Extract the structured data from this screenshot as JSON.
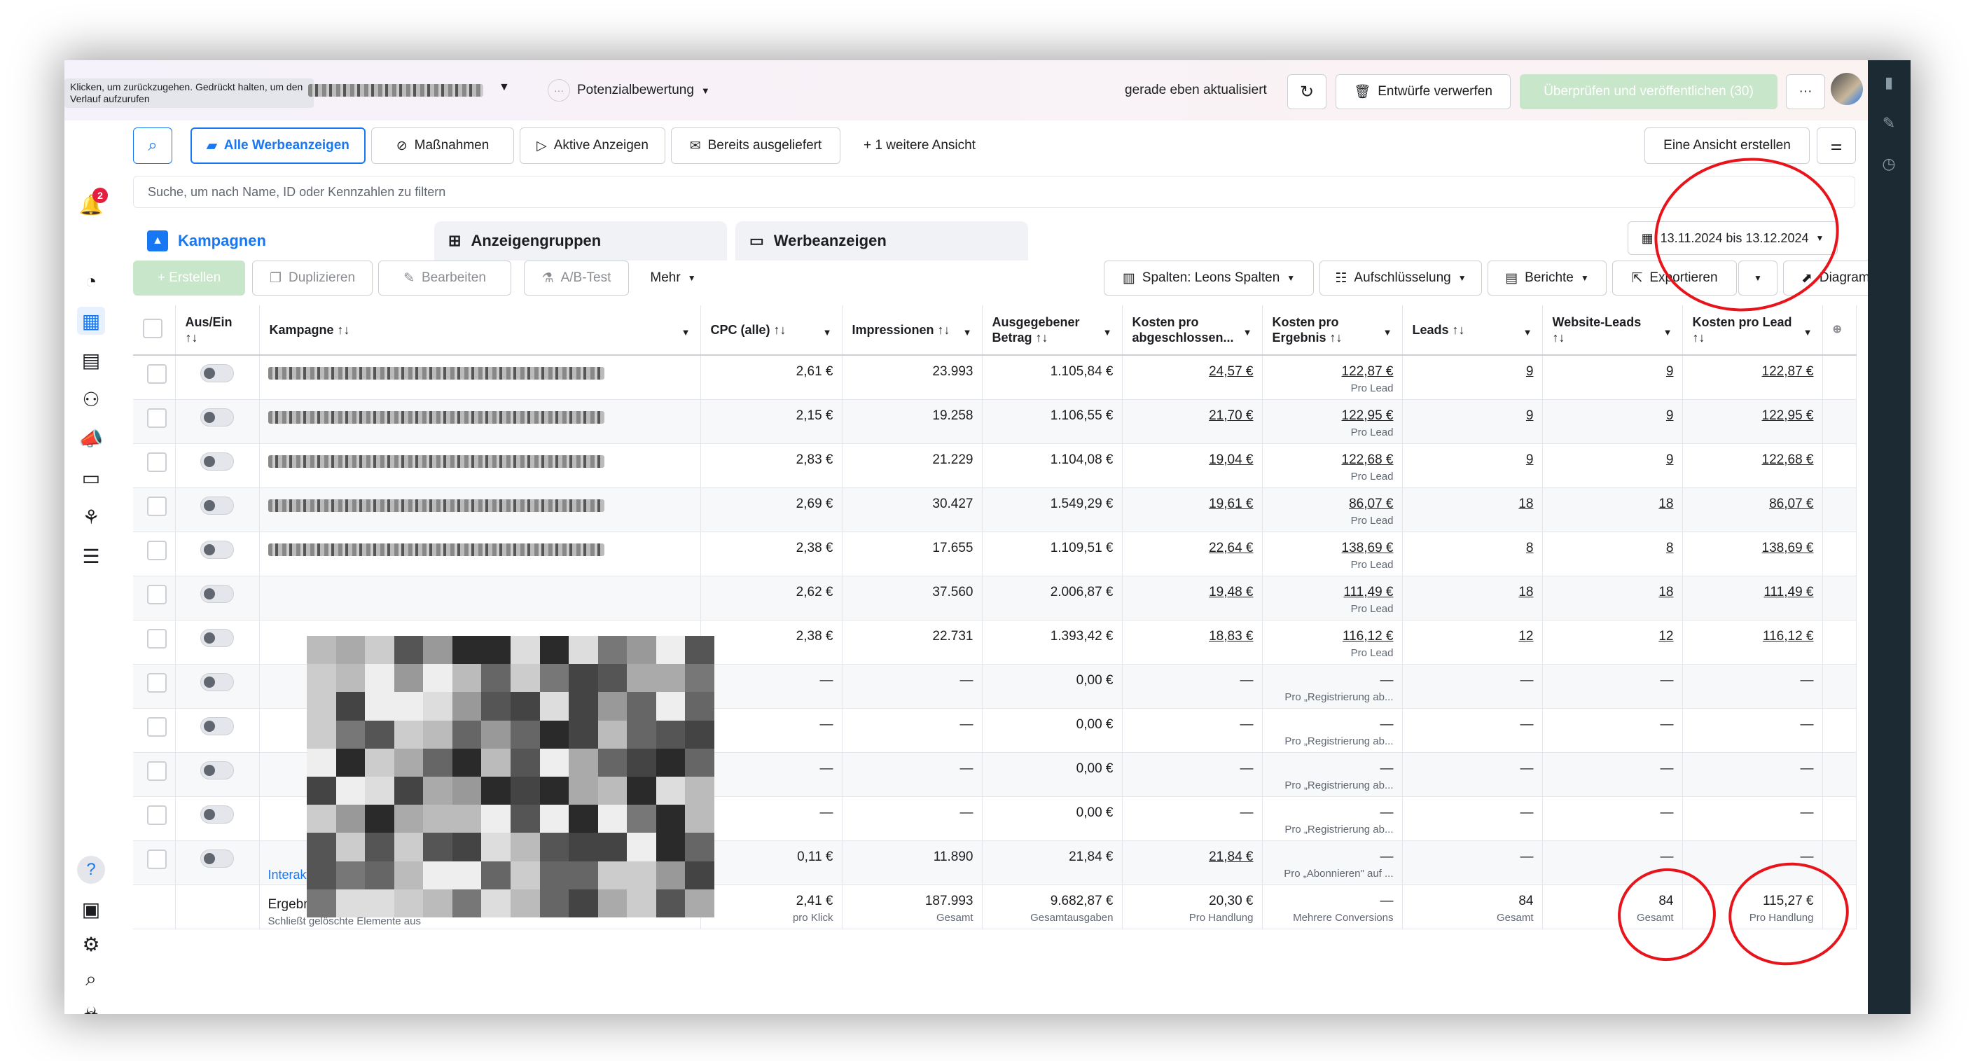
{
  "tooltip": "Klicken, um zurückzugehen. Gedrückt halten, um den Verlauf aufzurufen",
  "header": {
    "potential_label": "Potenzialbewertung",
    "updated": "gerade eben aktualisiert",
    "discard": "Entwürfe verwerfen",
    "publish": "Überprüfen und veröffentlichen (30)",
    "more": "···",
    "notification_count": "2"
  },
  "views": {
    "all_ads": "Alle Werbeanzeigen",
    "actions": "Maßnahmen",
    "active_ads": "Aktive Anzeigen",
    "delivered": "Bereits ausgeliefert",
    "more_view": "+ 1 weitere Ansicht",
    "create_view": "Eine Ansicht erstellen"
  },
  "search": {
    "placeholder": "Suche, um nach Name, ID oder Kennzahlen zu filtern"
  },
  "tabs": {
    "campaigns": "Kampagnen",
    "adsets": "Anzeigengruppen",
    "ads": "Werbeanzeigen"
  },
  "date_range": "13.11.2024 bis 13.12.2024",
  "toolbar": {
    "create": "+ Erstellen",
    "duplicate": "Duplizieren",
    "edit": "Bearbeiten",
    "abtest": "A/B-Test",
    "more": "Mehr",
    "columns": "Spalten: Leons Spalten",
    "breakdown": "Aufschlüsselung",
    "reports": "Berichte",
    "export": "Exportieren",
    "charts": "Diagramme"
  },
  "columns": {
    "onoff": "Aus/Ein",
    "sortglyph": "↑↓",
    "campaign": "Kampagne ↑↓",
    "cpc": "CPC (alle) ↑↓",
    "impressions": "Impressionen ↑↓",
    "spend_a": "Ausgegebener",
    "spend_b": "Betrag ↑↓",
    "cost_complete_a": "Kosten pro",
    "cost_complete_b": "abgeschlossen...",
    "cost_result_a": "Kosten pro",
    "cost_result_b": "Ergebnis ↑↓",
    "leads": "Leads ↑↓",
    "website_leads_a": "Website-Leads",
    "website_leads_b": "↑↓",
    "cost_lead_a": "Kosten pro Lead",
    "cost_lead_b": "↑↓"
  },
  "rows": [
    {
      "cpc": "2,61 €",
      "impr": "23.993",
      "spend": "1.105,84 €",
      "ccomp": "24,57 €",
      "cres": "122,87 €",
      "cres_sub": "Pro Lead",
      "leads": "9",
      "wleads": "9",
      "clead": "122,87 €"
    },
    {
      "cpc": "2,15 €",
      "impr": "19.258",
      "spend": "1.106,55 €",
      "ccomp": "21,70 €",
      "cres": "122,95 €",
      "cres_sub": "Pro Lead",
      "leads": "9",
      "wleads": "9",
      "clead": "122,95 €"
    },
    {
      "cpc": "2,83 €",
      "impr": "21.229",
      "spend": "1.104,08 €",
      "ccomp": "19,04 €",
      "cres": "122,68 €",
      "cres_sub": "Pro Lead",
      "leads": "9",
      "wleads": "9",
      "clead": "122,68 €"
    },
    {
      "cpc": "2,69 €",
      "impr": "30.427",
      "spend": "1.549,29 €",
      "ccomp": "19,61 €",
      "cres": "86,07 €",
      "cres_sub": "Pro Lead",
      "leads": "18",
      "wleads": "18",
      "clead": "86,07 €"
    },
    {
      "cpc": "2,38 €",
      "impr": "17.655",
      "spend": "1.109,51 €",
      "ccomp": "22,64 €",
      "cres": "138,69 €",
      "cres_sub": "Pro Lead",
      "leads": "8",
      "wleads": "8",
      "clead": "138,69 €"
    },
    {
      "cpc": "2,62 €",
      "impr": "37.560",
      "spend": "2.006,87 €",
      "ccomp": "19,48 €",
      "cres": "111,49 €",
      "cres_sub": "Pro Lead",
      "leads": "18",
      "wleads": "18",
      "clead": "111,49 €"
    },
    {
      "cpc": "2,38 €",
      "impr": "22.731",
      "spend": "1.393,42 €",
      "ccomp": "18,83 €",
      "cres": "116,12 €",
      "cres_sub": "Pro Lead",
      "leads": "12",
      "wleads": "12",
      "clead": "116,12 €"
    },
    {
      "cpc": "—",
      "impr": "—",
      "spend": "0,00 €",
      "ccomp": "—",
      "cres": "—",
      "cres_sub": "Pro „Registrierung ab...",
      "leads": "—",
      "wleads": "—",
      "clead": "—"
    },
    {
      "cpc": "—",
      "impr": "—",
      "spend": "0,00 €",
      "ccomp": "—",
      "cres": "—",
      "cres_sub": "Pro „Registrierung ab...",
      "leads": "—",
      "wleads": "—",
      "clead": "—"
    },
    {
      "cpc": "—",
      "impr": "—",
      "spend": "0,00 €",
      "ccomp": "—",
      "cres": "—",
      "cres_sub": "Pro „Registrierung ab...",
      "leads": "—",
      "wleads": "—",
      "clead": "—"
    },
    {
      "cpc": "—",
      "impr": "—",
      "spend": "0,00 €",
      "ccomp": "—",
      "cres": "—",
      "cres_sub": "Pro „Registrierung ab...",
      "leads": "—",
      "wleads": "—",
      "clead": "—"
    },
    {
      "cpc": "0,11 €",
      "impr": "11.890",
      "spend": "21,84 €",
      "ccomp": "21,84 €",
      "cres": "—",
      "cres_sub": "Pro „Abonnieren\" auf ...",
      "leads": "—",
      "wleads": "—",
      "clead": "—",
      "name_visible": "Interaktionen | Aufwärmen"
    }
  ],
  "totals": {
    "label": "Ergebnisse aus 17 Kampagnen",
    "sub": "Schließt gelöschte Elemente aus",
    "cpc": "2,41 €",
    "cpc_sub": "pro Klick",
    "impr": "187.993",
    "impr_sub": "Gesamt",
    "spend": "9.682,87 €",
    "spend_sub": "Gesamtausgaben",
    "ccomp": "20,30 €",
    "ccomp_sub": "Pro Handlung",
    "cres": "—",
    "cres_sub": "Mehrere Conversions",
    "leads": "84",
    "leads_sub": "Gesamt",
    "wleads": "84",
    "wleads_sub": "Gesamt",
    "clead": "115,27 €",
    "clead_sub": "Pro Handlung"
  },
  "colors": {
    "accent": "#1877f2",
    "annotation": "#e8141b",
    "sidebar_dark": "#1c2b33"
  }
}
